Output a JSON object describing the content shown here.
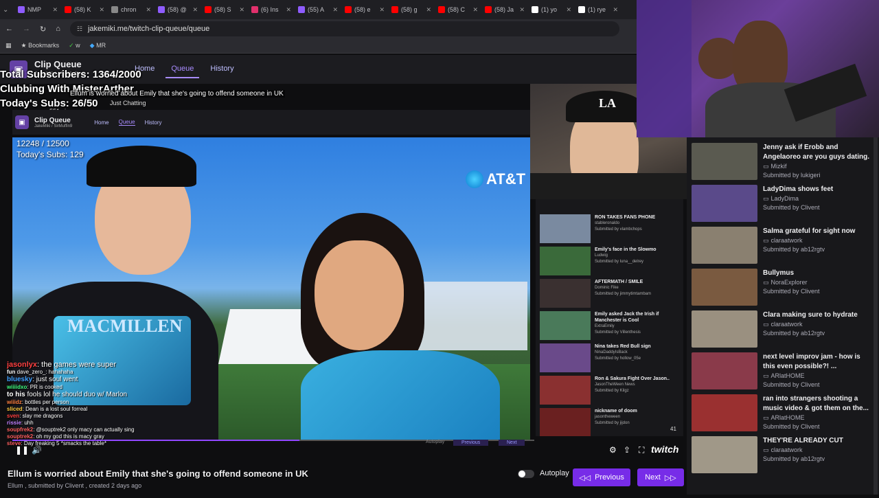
{
  "browser": {
    "tabs": [
      {
        "label": "NMP",
        "color": "#8f5cff"
      },
      {
        "label": "(58) K",
        "color": "#ff0000"
      },
      {
        "label": "chron",
        "color": "#888888"
      },
      {
        "label": "(58) @",
        "color": "#8f5cff"
      },
      {
        "label": "(58) S",
        "color": "#ff0000"
      },
      {
        "label": "(6) Ins",
        "color": "#e1306c"
      },
      {
        "label": "(55) A",
        "color": "#8f5cff"
      },
      {
        "label": "(58) e",
        "color": "#ff0000"
      },
      {
        "label": "(58) g",
        "color": "#ff0000"
      },
      {
        "label": "(58) C",
        "color": "#ff0000"
      },
      {
        "label": "(58) Ja",
        "color": "#ff0000"
      },
      {
        "label": "(1) yo",
        "color": "#ffffff"
      },
      {
        "label": "(1) rye",
        "color": "#ffffff"
      }
    ],
    "url": "jakemiki.me/twitch-clip-queue/queue",
    "bookmarks": [
      "Bookmarks",
      "w",
      "MR"
    ]
  },
  "site": {
    "title": "Clip Queue",
    "subtitle": "JakeMiki / SirMuffin9",
    "nav": [
      "Home",
      "Queue",
      "History"
    ]
  },
  "overlay": {
    "total_subs": "Total Subscribers: 1364/2000",
    "stream_title": "Clubbing With MisterArther",
    "todays_subs": "Today's Subs: 26/50",
    "clip_title": "Ellum is worried about Emily that she's going to offend someone in UK",
    "category": "Just Chatting",
    "views": "551 views"
  },
  "inner": {
    "title": "Clip Queue",
    "subtitle": "JakeMiki / SirMuffin9",
    "nav": [
      "Home",
      "Queue",
      "History"
    ],
    "sub_counter": "12248 / 12500",
    "today_subs": "Today's Subs: 129",
    "att": "AT&T"
  },
  "mid_queue": [
    {
      "title": "RON TAKES FANS PHONE",
      "channel": "stableronaldo",
      "submitter": "Submitted by vlambchops",
      "color": "#7a8aa0"
    },
    {
      "title": "Emily's face in the Slowmo",
      "channel": "Ludwig",
      "submitter": "Submitted by luna__delrey",
      "color": "#3a6a3a"
    },
    {
      "title": "AFTERMATH / SMILE",
      "channel": "Dominic Fike",
      "submitter": "Submitted by jimmytimtambam",
      "color": "#3a3030"
    },
    {
      "title": "Emily asked Jack the Irish if Manchester is Cool",
      "channel": "ExtraEmily",
      "submitter": "Submitted by Villenthesis",
      "color": "#4a7a5a"
    },
    {
      "title": "Nina takes Red Bull sign",
      "channel": "NinaDaddyIsBack",
      "submitter": "Submitted by hollow_05e",
      "color": "#6a4a8a"
    },
    {
      "title": "Ron & Sakura Fight Over Jason..",
      "channel": "JasonTheWeen News",
      "submitter": "Submitted by Kilgz",
      "color": "#8a3030"
    },
    {
      "title": "nickname of doom",
      "channel": "jasontheween",
      "submitter": "Submitted by jijdon",
      "color": "#6a2020"
    }
  ],
  "mid_queue_count": "41",
  "right_queue": [
    {
      "title": "Jenny ask if Erobb and Angelaoreo are you guys dating.",
      "channel": "Mizkif",
      "submitter": "Submitted by lukigeri",
      "color": "#5a5a50"
    },
    {
      "title": "LadyDima shows feet",
      "channel": "LadyDima",
      "submitter": "Submitted by Clivent",
      "color": "#5a4a8a"
    },
    {
      "title": "Salma grateful for sight now",
      "channel": "claraatwork",
      "submitter": "Submitted by ab12rgtv",
      "color": "#8a8070"
    },
    {
      "title": "Bullymus",
      "channel": "NoraExplorer",
      "submitter": "Submitted by Clivent",
      "color": "#7a5a40"
    },
    {
      "title": "Clara making sure to hydrate",
      "channel": "claraatwork",
      "submitter": "Submitted by ab12rgtv",
      "color": "#9a9080"
    },
    {
      "title": "next level improv jam - how is this even possible?! ...",
      "channel": "ARlatHOME",
      "submitter": "Submitted by Clivent",
      "color": "#8a3a4a"
    },
    {
      "title": "ran into strangers shooting a music video & got them on the...",
      "channel": "ARlatHOME",
      "submitter": "Submitted by Clivent",
      "color": "#9a3030"
    },
    {
      "title": "THEY'RE ALREADY CUT",
      "channel": "claraatwork",
      "submitter": "Submitted by ab12rgtv",
      "color": "#a09888"
    }
  ],
  "chat": [
    {
      "user": "jasonlyx",
      "msg": ": the games were super",
      "color": "#ff4040"
    },
    {
      "user": "fun",
      "msg": "dave_zero_: hahahaha",
      "color": "#ffffff"
    },
    {
      "user": "bluesky",
      "msg": ": just soul went",
      "color": "#40a0ff"
    },
    {
      "user": "wiiiidxo",
      "msg": ": PR is cooked",
      "color": "#40ff80"
    },
    {
      "user": "to his",
      "msg": "fools lol he should duo w/ Marlon",
      "color": "#ffffff"
    },
    {
      "user": "wiiidz",
      "msg": ": bottles per person",
      "color": "#ff8040"
    },
    {
      "user": "sliced",
      "msg": ": Dean is a lost soul forreal",
      "color": "#ffcc40"
    },
    {
      "user": "sven",
      "msg": ": slay me dragons",
      "color": "#ff4040"
    },
    {
      "user": "rissie",
      "msg": ": uhh",
      "color": "#c080ff"
    },
    {
      "user": "soupfrek2",
      "msg": ": @souptrek2 only macy can actually sing",
      "color": "#ff6060"
    },
    {
      "user": "souptrek2",
      "msg": ": oh my god this is macy gray",
      "color": "#ff6060"
    },
    {
      "user": "steve",
      "msg": ": Day freaking 5 *smacks the table*",
      "color": "#ff6060"
    }
  ],
  "bottom": {
    "title": "Ellum is worried about Emily that she's going to offend someone in UK",
    "meta": "Ellum , submitted by Clivent , created 2 days ago",
    "autoplay": "Autoplay",
    "previous": "Previous",
    "next": "Next"
  },
  "inner_controls": {
    "autoplay": "Autoplay",
    "previous": "Previous",
    "next": "Next"
  },
  "twitch_logo": "twitch"
}
